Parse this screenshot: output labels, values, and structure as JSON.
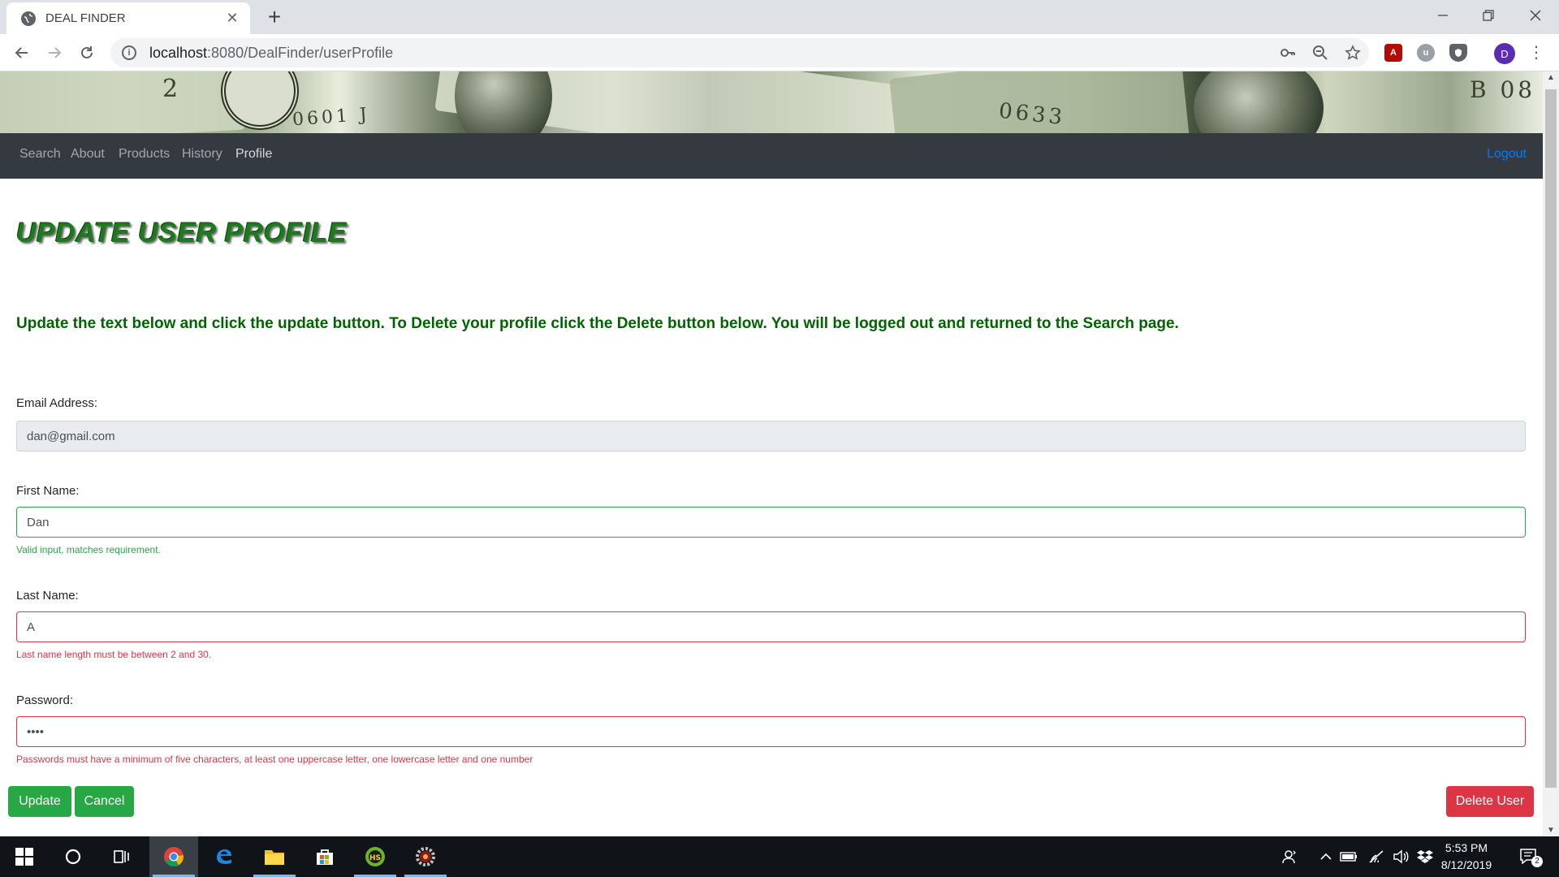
{
  "browser": {
    "tab_title": "DEAL FINDER",
    "tab_close": "✕",
    "new_tab": "+",
    "url_host": "localhost",
    "url_path": ":8080/DealFinder/userProfile",
    "profile_initial": "D"
  },
  "nav": {
    "links": [
      "Search",
      "About",
      "Products",
      "History",
      "Profile"
    ],
    "logout": "Logout"
  },
  "page": {
    "title": "UPDATE USER PROFILE",
    "instructions": "Update the text below and click the update button. To Delete your profile click the Delete button below. You will be logged out and returned to the Search page."
  },
  "form": {
    "email": {
      "label": "Email Address:",
      "value": "dan@gmail.com"
    },
    "first_name": {
      "label": "First Name:",
      "value": "Dan",
      "feedback": "Valid input, matches requirement."
    },
    "last_name": {
      "label": "Last Name:",
      "value": "A",
      "feedback": "Last name length must be between 2 and 30."
    },
    "password": {
      "label": "Password:",
      "value": "••••",
      "feedback": "Passwords must have a minimum of five characters, at least one uppercase letter, one lowercase letter and one number"
    }
  },
  "buttons": {
    "update": "Update",
    "cancel": "Cancel",
    "delete": "Delete User"
  },
  "taskbar": {
    "time": "5:53 PM",
    "date": "8/12/2019",
    "notification_count": "2"
  },
  "colors": {
    "nav_bg": "#343a40",
    "title_green": "#1e7a1e",
    "instruction_green": "#006400",
    "success": "#28a745",
    "danger": "#dc3545",
    "link_blue": "#007bff"
  }
}
